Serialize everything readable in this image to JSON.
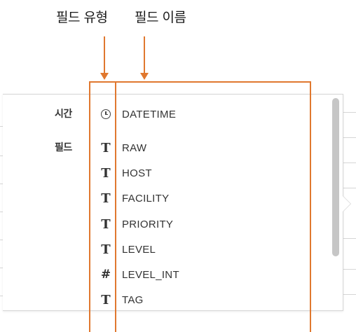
{
  "annotations": {
    "field_type": "필드 유형",
    "field_name": "필드 이름"
  },
  "sections": {
    "time": "시간",
    "field": "필드"
  },
  "time_field": {
    "icon": "clock-icon",
    "name": "DATETIME"
  },
  "fields": [
    {
      "icon": "text-type-icon",
      "glyph": "T",
      "name": "RAW"
    },
    {
      "icon": "text-type-icon",
      "glyph": "T",
      "name": "HOST"
    },
    {
      "icon": "text-type-icon",
      "glyph": "T",
      "name": "FACILITY"
    },
    {
      "icon": "text-type-icon",
      "glyph": "T",
      "name": "PRIORITY"
    },
    {
      "icon": "text-type-icon",
      "glyph": "T",
      "name": "LEVEL"
    },
    {
      "icon": "number-type-icon",
      "glyph": "#",
      "name": "LEVEL_INT"
    },
    {
      "icon": "text-type-icon",
      "glyph": "T",
      "name": "TAG"
    }
  ],
  "colors": {
    "annotation": "#e0782f",
    "border": "#d6d6d6",
    "scrollbar": "#c6c6c6"
  }
}
